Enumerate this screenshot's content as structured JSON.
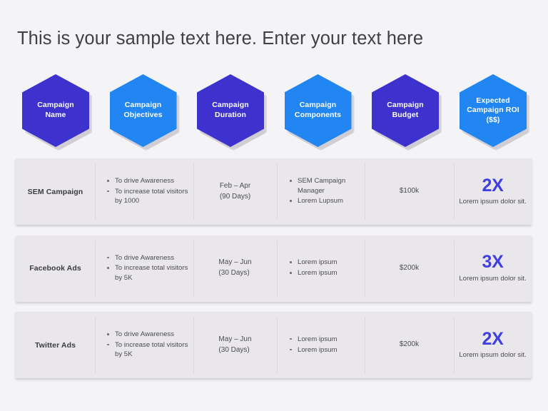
{
  "slide": {
    "background_color": "#f4f3f5",
    "title": "This is your sample text here. Enter your text here"
  },
  "theme": {
    "hex_dark": "#3d32ce",
    "hex_light": "#2186f2",
    "row_background": "#e9e7ea",
    "roi_accent": "#4040e2",
    "title_color": "#3f3f46"
  },
  "headers": [
    {
      "label": "Campaign Name",
      "color": "#3d32ce",
      "tone": "dark"
    },
    {
      "label": "Campaign Objectives",
      "color": "#2186f2",
      "tone": "light"
    },
    {
      "label": "Campaign Duration",
      "color": "#3d32ce",
      "tone": "dark"
    },
    {
      "label": "Campaign Components",
      "color": "#2186f2",
      "tone": "light"
    },
    {
      "label": "Campaign Budget",
      "color": "#3d32ce",
      "tone": "dark"
    },
    {
      "label": "Expected Campaign ROI ($$)",
      "color": "#2186f2",
      "tone": "light"
    }
  ],
  "rows": [
    {
      "name": "SEM Campaign",
      "objectives": [
        "To drive Awareness",
        "To increase total visitors by 1000"
      ],
      "duration": "Feb – Apr",
      "duration_days": "(90 Days)",
      "components": [
        "SEM Campaign Manager",
        "Lorem Lupsum"
      ],
      "budget": "$100k",
      "roi_value": "2X",
      "roi_note": "Lorem ipsum dolor sit."
    },
    {
      "name": "Facebook Ads",
      "objectives": [
        "To drive Awareness",
        "To increase total visitors by 5K"
      ],
      "duration": "May – Jun",
      "duration_days": "(30 Days)",
      "components": [
        "Lorem ipsum",
        "Lorem ipsum"
      ],
      "budget": "$200k",
      "roi_value": "3X",
      "roi_note": "Lorem ipsum dolor sit."
    },
    {
      "name": "Twitter Ads",
      "objectives": [
        "To drive Awareness",
        "To increase total visitors by 5K"
      ],
      "duration": "May – Jun",
      "duration_days": "(30 Days)",
      "components": [
        "Lorem ipsum",
        "Lorem ipsum"
      ],
      "budget": "$200k",
      "roi_value": "2X",
      "roi_note": "Lorem ipsum dolor sit."
    }
  ]
}
